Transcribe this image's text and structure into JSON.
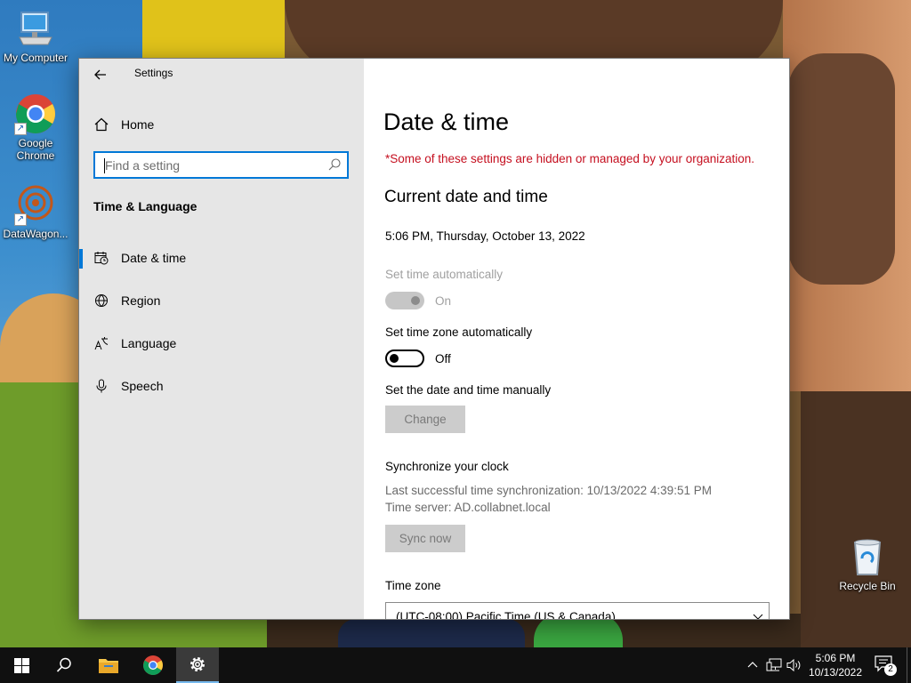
{
  "desktop": {
    "icons": [
      {
        "label": "My Computer",
        "icon": "computer-icon"
      },
      {
        "label": "Google Chrome",
        "icon": "chrome-icon"
      },
      {
        "label": "DataWagon...",
        "icon": "datawagon-icon"
      },
      {
        "label": "Recycle Bin",
        "icon": "recycle-bin-icon"
      }
    ]
  },
  "window": {
    "title": "Settings",
    "back_icon": "back-arrow-icon",
    "caption": {
      "minimize": "minimize-icon",
      "maximize": "maximize-icon",
      "close": "close-icon"
    }
  },
  "nav": {
    "home_label": "Home",
    "search_placeholder": "Find a setting",
    "section_title": "Time & Language",
    "items": [
      {
        "label": "Date & time",
        "icon": "date-time-icon",
        "selected": true
      },
      {
        "label": "Region",
        "icon": "region-icon",
        "selected": false
      },
      {
        "label": "Language",
        "icon": "language-icon",
        "selected": false
      },
      {
        "label": "Speech",
        "icon": "microphone-icon",
        "selected": false
      }
    ]
  },
  "content": {
    "title": "Date & time",
    "managed_warning": "*Some of these settings are hidden or managed by your organization.",
    "section_title": "Current date and time",
    "current_datetime": "5:06 PM, Thursday, October 13, 2022",
    "set_time_auto": {
      "label": "Set time automatically",
      "state": "On",
      "enabled": false
    },
    "set_tz_auto": {
      "label": "Set time zone automatically",
      "state": "Off",
      "enabled": true
    },
    "manual": {
      "label": "Set the date and time manually",
      "button": "Change"
    },
    "sync": {
      "label": "Synchronize your clock",
      "last_sync": "Last successful time synchronization: 10/13/2022 4:39:51 PM",
      "server": "Time server: AD.collabnet.local",
      "button": "Sync now"
    },
    "timezone": {
      "label": "Time zone",
      "value": "(UTC-08:00) Pacific Time (US & Canada)"
    }
  },
  "taskbar": {
    "apps": [
      "start-icon",
      "search-icon",
      "file-explorer-icon",
      "chrome-icon",
      "settings-gear-icon"
    ],
    "active_app": "settings-gear-icon",
    "tray": [
      "chevron-up-icon",
      "network-icon",
      "volume-icon"
    ],
    "clock_time": "5:06 PM",
    "clock_date": "10/13/2022",
    "notification_count": "2"
  },
  "colors": {
    "accent": "#0078d7",
    "warning": "#c50f1f",
    "nav_bg": "#e6e6e6",
    "taskbar_bg": "#101010"
  }
}
